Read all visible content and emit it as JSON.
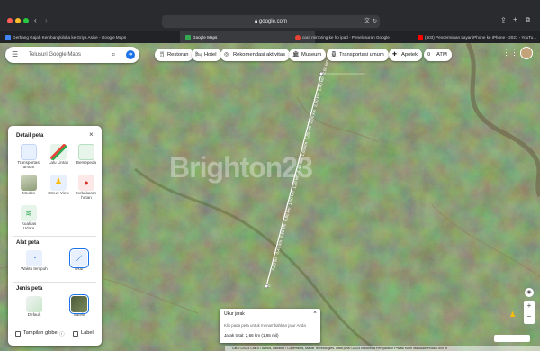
{
  "browser": {
    "url": "google.com",
    "tabs": [
      {
        "label": "Gerbang Gajah Kembangkiloka ke Griya Asike - Google Maps",
        "color": "#4285f4"
      },
      {
        "label": "Google Maps",
        "color": "#34a853"
      },
      {
        "label": "cara mirroring ke hp ipad - Penelusuran Google",
        "color": "#ea4335"
      },
      {
        "label": "(403) Pencerminan Layar iPhone ke iPhone - 2021 - YouTu...",
        "color": "#ff0000"
      }
    ]
  },
  "search": {
    "placeholder": "Telusuri Google Maps"
  },
  "chips": [
    "Restoran",
    "Hotel",
    "Rekomendasi aktivitas",
    "Museum",
    "Transportasi umum",
    "Apotek",
    "ATM"
  ],
  "panel": {
    "map_details_title": "Detail peta",
    "details": [
      "Transportasi umum",
      "Lalu Lintas",
      "Bersepeda",
      "Medan",
      "Street View",
      "Kebakaran hutan",
      "Kualitas Udara"
    ],
    "tools_title": "Alat peta",
    "tools": [
      "Waktu tempuh",
      "Ukur"
    ],
    "type_title": "Jenis peta",
    "types": [
      "Default",
      "Satelit"
    ],
    "globe_label": "Tampilan globe",
    "label_label": "Label"
  },
  "measure": {
    "title": "Ukur jarak",
    "hint": "Klik pada peta untuk menambahkan jalur Anda",
    "total": "Jarak total: 2,66 km (1,65 mil)"
  },
  "route_labels": [
    "0",
    "0,20 km",
    "0,40 km",
    "0,60 km",
    "0,80 km",
    "1,00 km",
    "1,20 km",
    "1,40 km",
    "1,60 km",
    "1,80 km",
    "2,00 km",
    "2,20 km",
    "2,40 km",
    "2,60 km"
  ],
  "watermark": "Brighton23",
  "copyright": "Citra ©2024 CNES / Airbus, Landsat / Copernicus, Maxar Technologies, Data peta ©2024    Indonesia    Persyaratan    Privasi    Kirim Masukan Produk    500 m"
}
